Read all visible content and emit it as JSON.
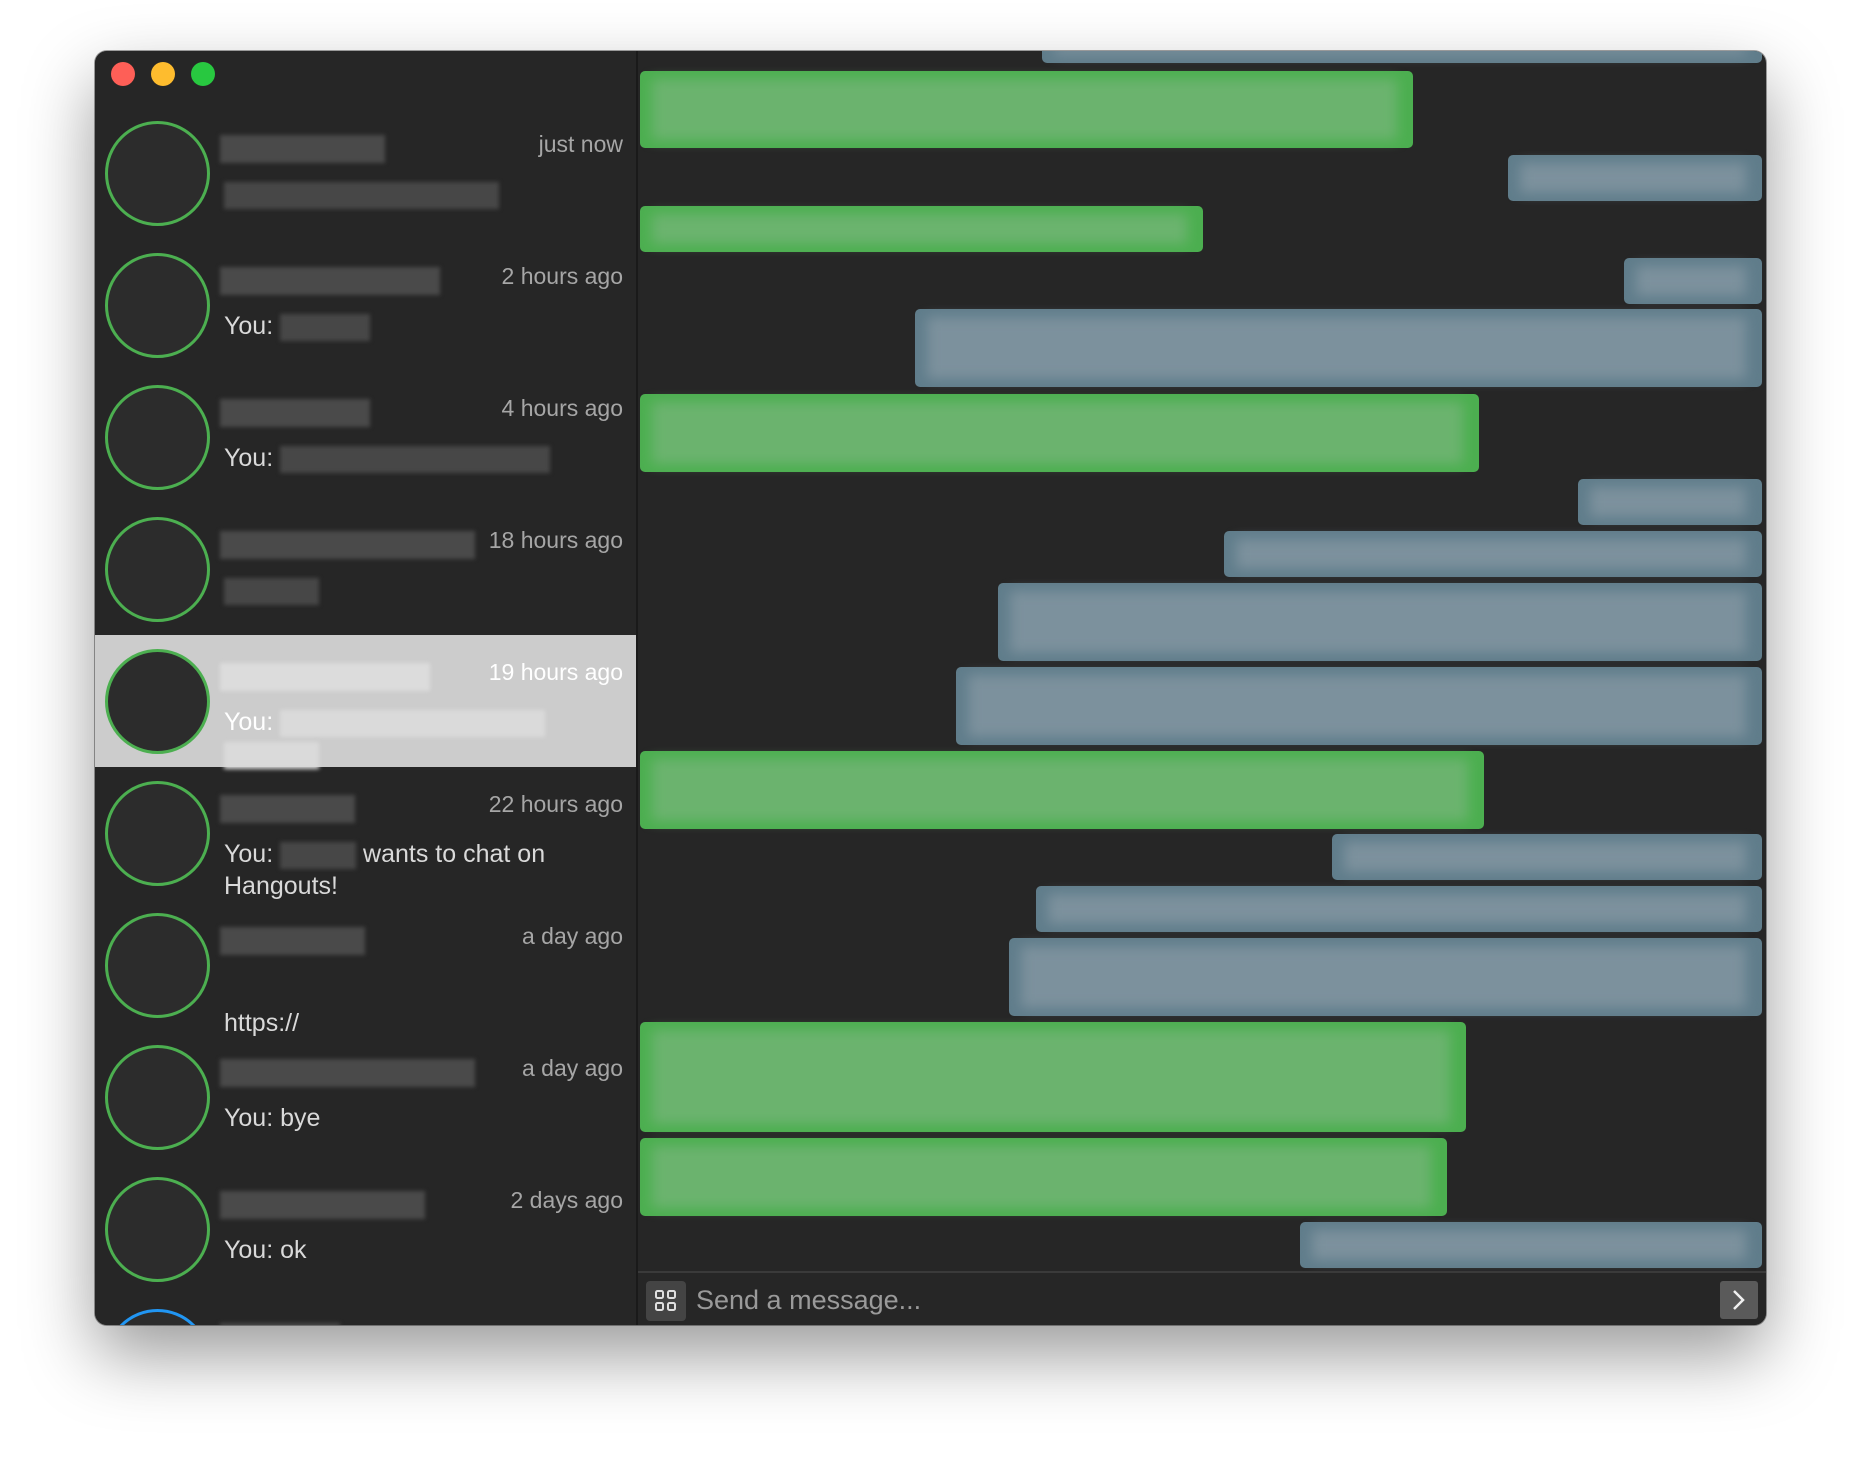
{
  "conversations": [
    {
      "time": "just now",
      "preview_prefix": "",
      "preview_suffix": "",
      "selected": false
    },
    {
      "time": "2 hours ago",
      "preview_prefix": "You:",
      "preview_suffix": "",
      "selected": false
    },
    {
      "time": "4 hours ago",
      "preview_prefix": "You:",
      "preview_suffix": "",
      "selected": false
    },
    {
      "time": "18 hours ago",
      "preview_prefix": "",
      "preview_suffix": "",
      "selected": false
    },
    {
      "time": "19 hours ago",
      "preview_prefix": "You:",
      "preview_suffix": "",
      "selected": true
    },
    {
      "time": "22 hours ago",
      "preview_prefix": "You:",
      "preview_suffix": "wants to chat on Hangouts!",
      "selected": false
    },
    {
      "time": "a day ago",
      "preview_prefix": "https://",
      "preview_suffix": "",
      "selected": false
    },
    {
      "time": "a day ago",
      "preview_prefix": "You: bye",
      "preview_suffix": "",
      "selected": false
    },
    {
      "time": "2 days ago",
      "preview_prefix": "You: ok",
      "preview_suffix": "",
      "selected": false
    }
  ],
  "composer": {
    "placeholder": "Send a message..."
  },
  "colors": {
    "window_bg": "#262626",
    "sent_bubble": "#4caf50",
    "received_bubble": "#607d8b",
    "avatar_ring": "#4caf50",
    "selected_row": "#cccccc"
  }
}
